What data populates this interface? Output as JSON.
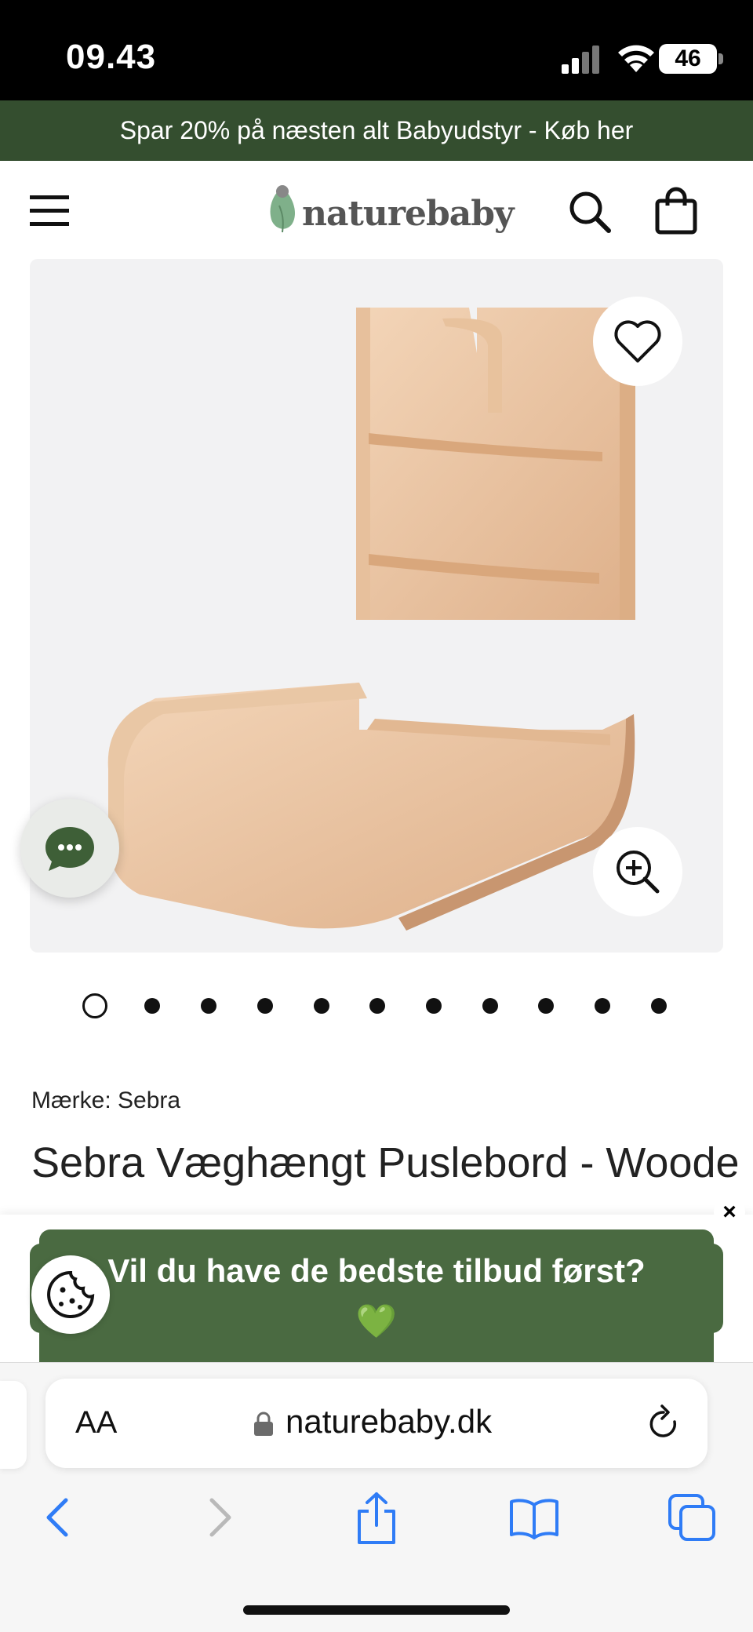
{
  "status_bar": {
    "time": "09.43",
    "battery": "46"
  },
  "promo_banner": {
    "text": "Spar 20% på næsten alt Babyudstyr - Køb her"
  },
  "header": {
    "logo_text": "naturebaby"
  },
  "product": {
    "brand": "Mærke: Sebra",
    "title": "Sebra Væghængt Puslebord - Wooden Edition",
    "image_count": 11,
    "active_image": 1
  },
  "popup": {
    "text": "Vil du have de bedste tilbud først?",
    "emoji": "💚",
    "close": "×"
  },
  "browser": {
    "text_size_label": "AA",
    "url": "naturebaby.dk"
  },
  "colors": {
    "promo_bg": "#344e2f",
    "popup_bg": "#4a6a41",
    "safari_blue": "#2f7cf6"
  }
}
